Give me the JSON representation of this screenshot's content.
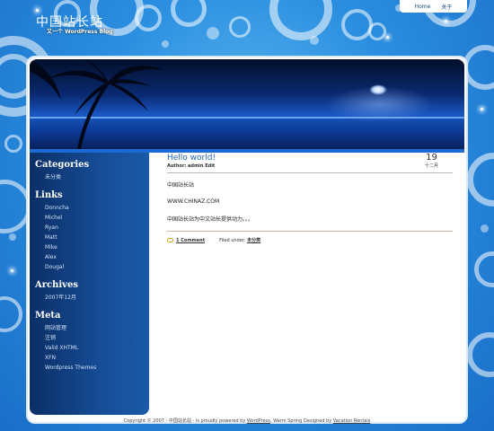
{
  "header": {
    "title": "中国站长站",
    "tagline": "又一个 WordPress Blog"
  },
  "topnav": {
    "items": [
      "Home",
      "关于"
    ]
  },
  "sidebar": {
    "categories": {
      "heading": "Categories",
      "items": [
        "未分类"
      ]
    },
    "links": {
      "heading": "Links",
      "items": [
        "Donncha",
        "Michel",
        "Ryan",
        "Matt",
        "Mike",
        "Alex",
        "Dougal"
      ]
    },
    "archives": {
      "heading": "Archives",
      "items": [
        "2007年12月"
      ]
    },
    "meta": {
      "heading": "Meta",
      "items": [
        "网站管理",
        "注销",
        "Valid XHTML",
        "XFN",
        "Wordpress Themes"
      ]
    }
  },
  "post": {
    "title": "Hello world!",
    "author": "Author: admin Edit",
    "day": "19",
    "month": "十二月",
    "paragraphs": [
      "中国站长站",
      "WWW.CHINAZ.COM",
      "中国站长站为中文站长提供动力。。。"
    ],
    "comments": "1 Comment",
    "filed_label": "Filed under:",
    "filed_category": "未分类"
  },
  "footer": {
    "prefix": "Copyright © 2007 - 中国站长站  - is proudly powered by ",
    "wordpress": "WordPress",
    "mid": ", Warm Spring Designed by ",
    "designer": "Vacation Rentals"
  },
  "colors": {
    "background": "#2a8ee0",
    "sidebar": "#164d97",
    "title_link": "#2466bd"
  }
}
